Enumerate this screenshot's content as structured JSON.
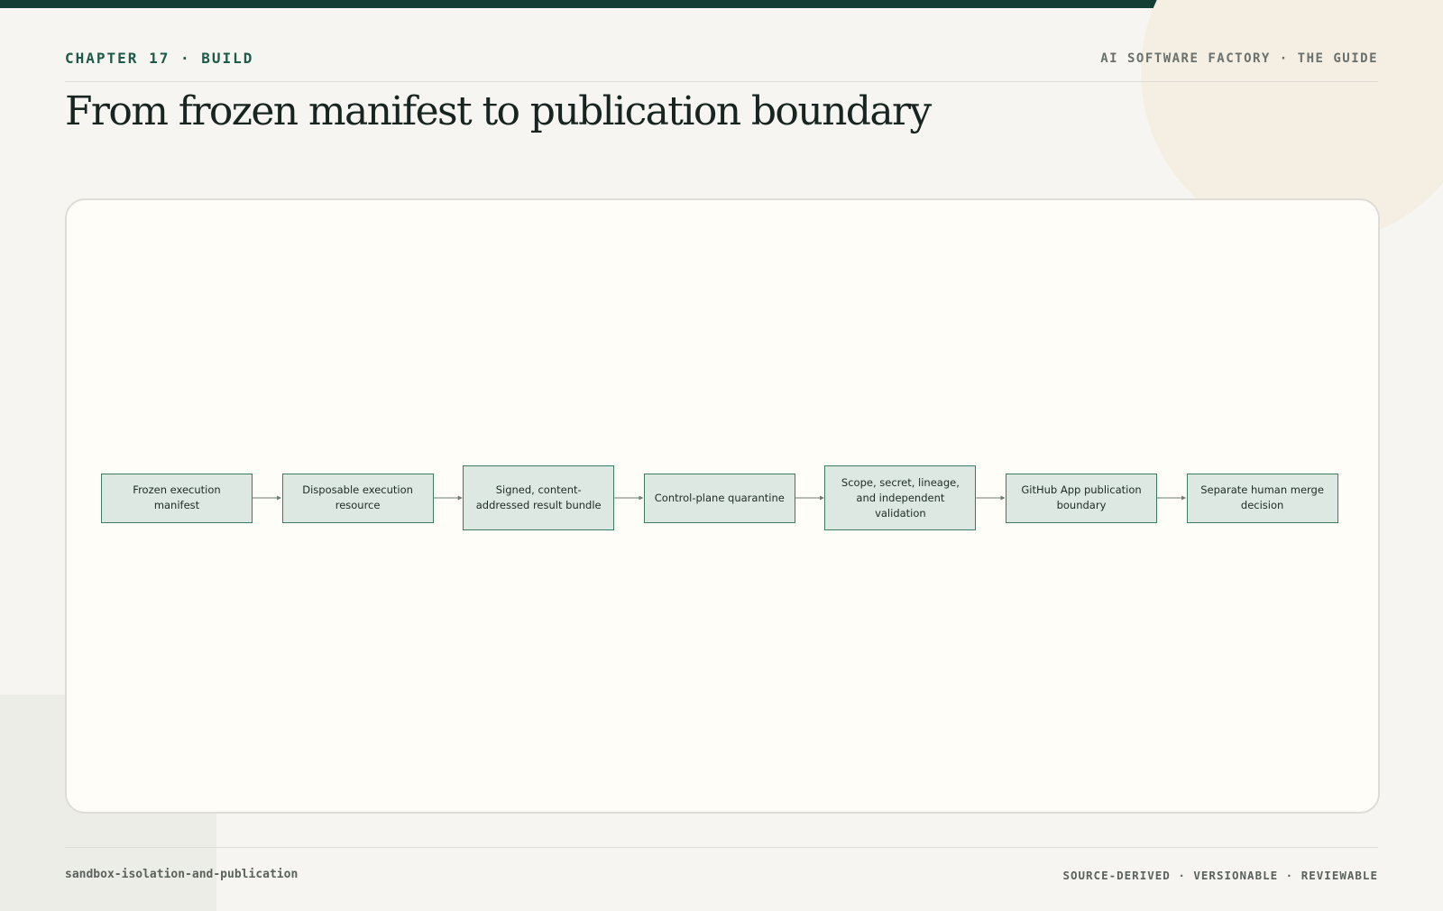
{
  "header": {
    "chapter": "CHAPTER 17 · BUILD",
    "guide": "AI SOFTWARE FACTORY · THE GUIDE",
    "title": "From frozen manifest to publication boundary"
  },
  "diagram": {
    "steps": [
      {
        "label": "Frozen execution manifest"
      },
      {
        "label": "Disposable execution resource"
      },
      {
        "label": "Signed, content-addressed result bundle"
      },
      {
        "label": "Control-plane quarantine"
      },
      {
        "label": "Scope, secret, lineage, and independent validation"
      },
      {
        "label": "GitHub App publication boundary"
      },
      {
        "label": "Separate human merge decision"
      }
    ],
    "colors": {
      "box_fill": "#dce8e1",
      "box_border": "#3d7a62",
      "arrow": "#6f7a75"
    }
  },
  "footer": {
    "slug": "sandbox-isolation-and-publication",
    "tagline": "SOURCE-DERIVED · VERSIONABLE · REVIEWABLE"
  },
  "theme": {
    "accent": "#143d33",
    "background": "#f6f5f1",
    "panel": "#fefdf8"
  }
}
